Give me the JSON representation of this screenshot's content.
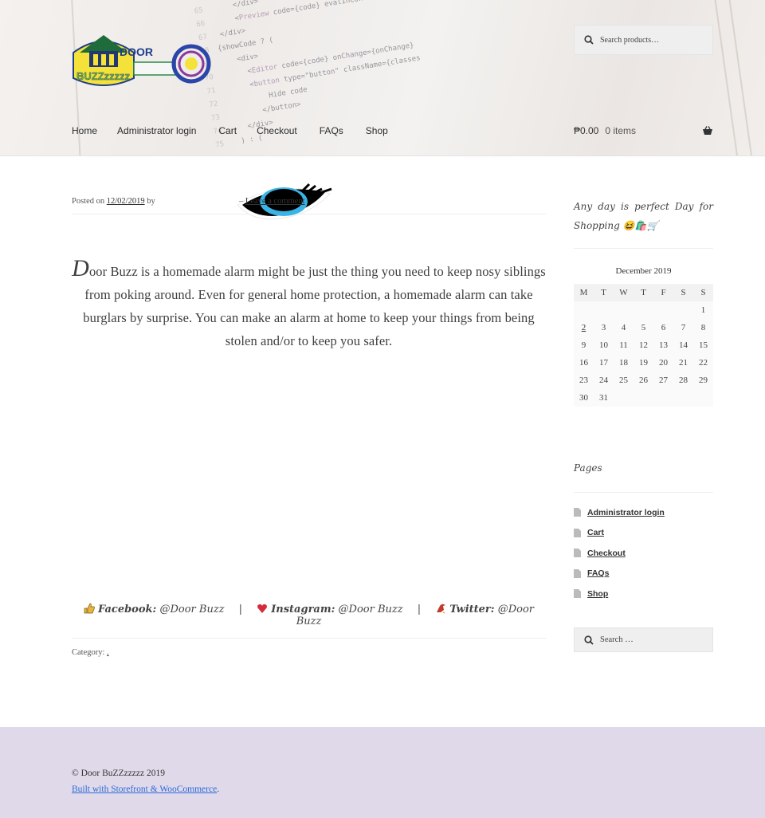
{
  "header": {
    "search_placeholder": "Search products…",
    "nav": [
      "Home",
      "Administrator login",
      "Cart",
      "Checkout",
      "FAQs",
      "Shop"
    ],
    "cart_total": "₱0.00",
    "cart_count": "0 items"
  },
  "post": {
    "posted_on_label": "Posted on",
    "date": "12/02/2019",
    "by_label": "by",
    "leave_comment": "Leave a comment",
    "dropcap": "D",
    "body": "oor Buzz is a homemade alarm might be just the thing you need to keep nosy siblings from poking around. Even for general home protection, a homemade alarm can take burglars by surprise. You can make an alarm at home to keep your things from being stolen and/or to keep you safer.",
    "social": [
      {
        "label": "Facebook:",
        "handle": "@Door Buzz",
        "icon": "thumbs-up-icon"
      },
      {
        "label": "Instagram:",
        "handle": "@Door Buzz",
        "icon": "heart-icon"
      },
      {
        "label": "Twitter:",
        "handle": "@Door Buzz",
        "icon": "bird-icon"
      }
    ],
    "category_label": "Category:",
    "category_value": "."
  },
  "sidebar": {
    "tagline": "Any day is perfect Day for Shopping 😆🛍️🛒",
    "calendar": {
      "caption": "December 2019",
      "weekdays": [
        "M",
        "T",
        "W",
        "T",
        "F",
        "S",
        "S"
      ],
      "weeks": [
        [
          "",
          "",
          "",
          "",
          "",
          "",
          "1"
        ],
        [
          "2",
          "3",
          "4",
          "5",
          "6",
          "7",
          "8"
        ],
        [
          "9",
          "10",
          "11",
          "12",
          "13",
          "14",
          "15"
        ],
        [
          "16",
          "17",
          "18",
          "19",
          "20",
          "21",
          "22"
        ],
        [
          "23",
          "24",
          "25",
          "26",
          "27",
          "28",
          "29"
        ],
        [
          "30",
          "31",
          "",
          "",
          "",
          "",
          ""
        ]
      ],
      "linked_day": "2"
    },
    "pages_title": "Pages",
    "pages": [
      "Administrator login",
      "Cart",
      "Checkout",
      "FAQs",
      "Shop"
    ],
    "search_placeholder": "Search …"
  },
  "footer": {
    "copyright": "© Door BuZZzzzzz 2019",
    "built_with": "Built with Storefront & WooCommerce",
    "built_suffix": "."
  },
  "colors": {
    "footer_bg": "#e0d9e9",
    "link_blue": "#2b6ad9",
    "text": "#43454b"
  }
}
